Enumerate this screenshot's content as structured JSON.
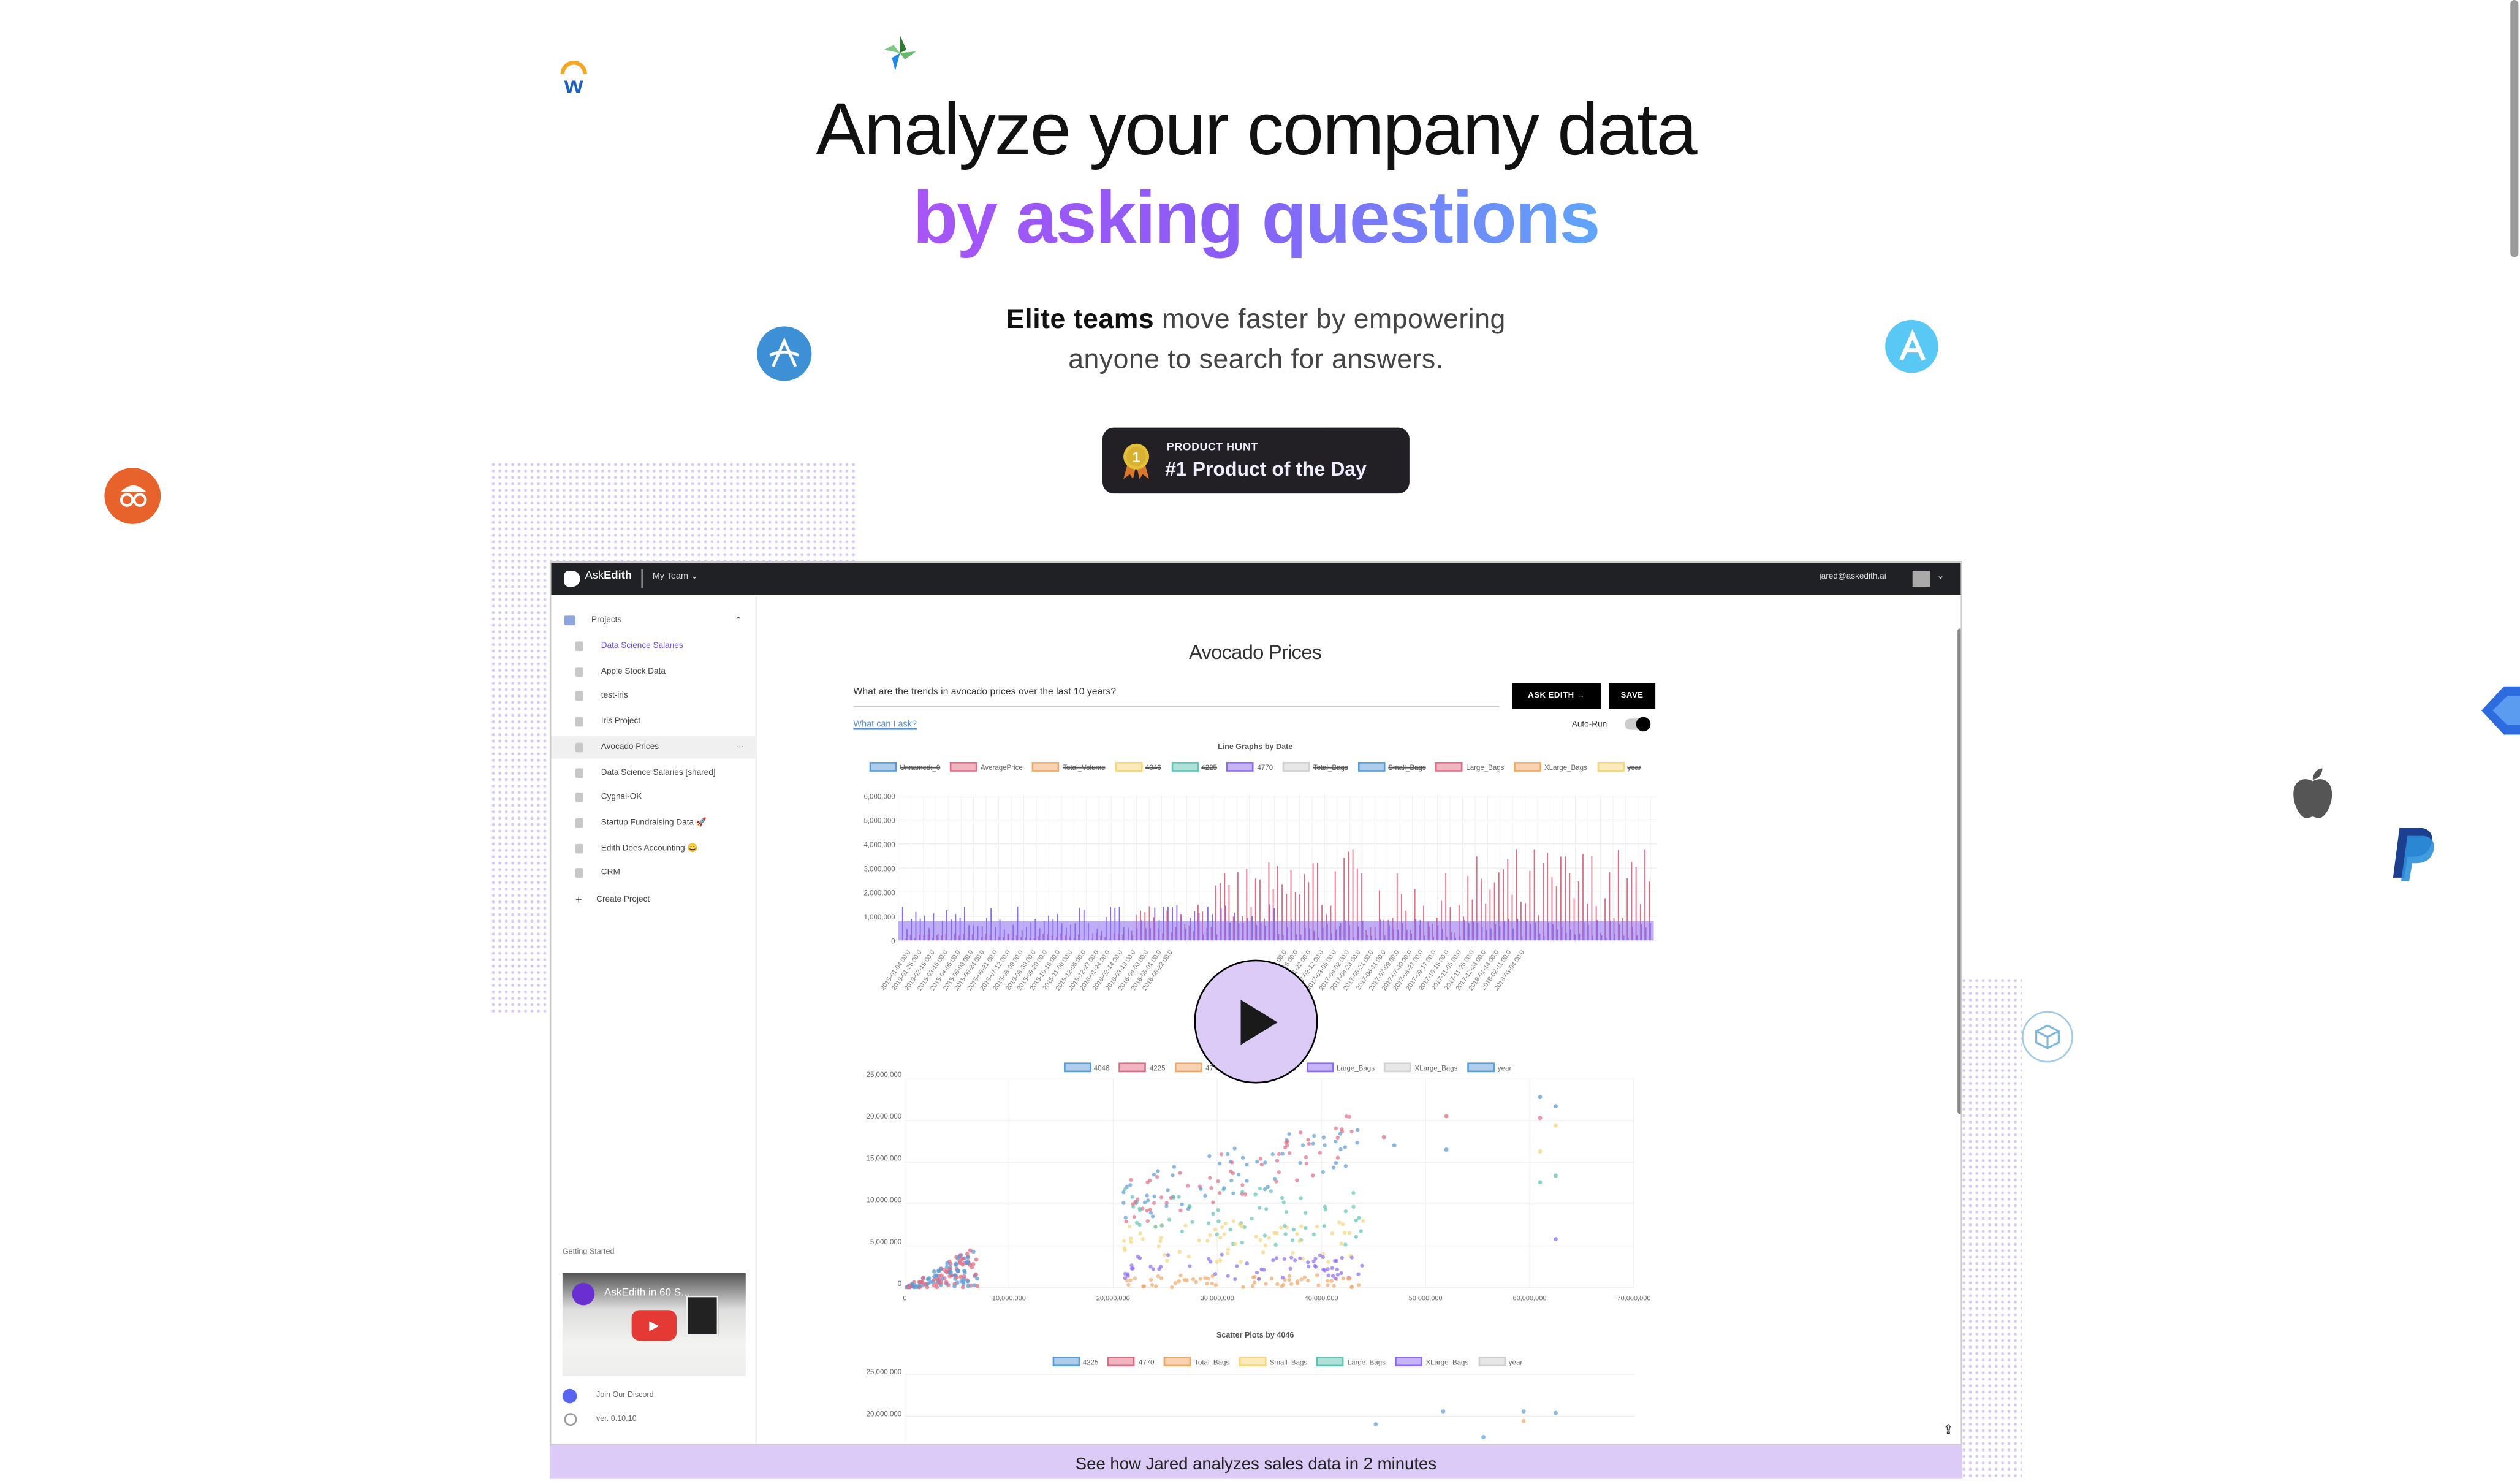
{
  "hero": {
    "title_line1": "Analyze your company data",
    "title_line2": "by asking questions",
    "subtitle_bold": "Elite teams",
    "subtitle_rest": " move faster by empowering",
    "subtitle_line2": "anyone to search for answers."
  },
  "badge": {
    "label": "PRODUCT HUNT",
    "title": "#1 Product of the Day",
    "medal_number": "1"
  },
  "logos": [
    "workday-icon",
    "leaf-diamond-icon",
    "letter-a-circle-icon",
    "letter-a-light-circle-icon",
    "glasses-face-icon",
    "arrow-chevron-icon",
    "apple-icon",
    "paypal-icon",
    "cube-cycle-icon"
  ],
  "app": {
    "brand_prefix": "Ask",
    "brand_suffix": "Edith",
    "team": "My Team",
    "user_email": "jared@askedith.ai",
    "sidebar": {
      "projects_label": "Projects",
      "items": [
        {
          "label": "Data Science Salaries",
          "active": true
        },
        {
          "label": "Apple Stock Data"
        },
        {
          "label": "test-iris"
        },
        {
          "label": "Iris Project"
        },
        {
          "label": "Avocado Prices",
          "selected": true
        },
        {
          "label": "Data Science Salaries [shared]"
        },
        {
          "label": "Cygnal-OK"
        },
        {
          "label": "Startup Fundraising Data 🚀"
        },
        {
          "label": "Edith Does Accounting 😀"
        },
        {
          "label": "CRM"
        }
      ],
      "more": "···",
      "create_project": "Create Project",
      "getting_started": "Getting Started",
      "video_title": "AskEdith in 60 S...",
      "discord": "Join Our Discord",
      "version": "ver. 0.10.10"
    },
    "main": {
      "page_title": "Avocado Prices",
      "query": "What are the trends in avocado prices over the last 10 years?",
      "ask_button": "ASK EDITH →",
      "save_button": "SAVE",
      "help_link": "What can I ask?",
      "autorun_label": "Auto-Run",
      "autorun_on": true
    },
    "chart1": {
      "title": "Line Graphs by Date",
      "legend": [
        {
          "label": "Unnamed:_0",
          "color": "#5b9bd5",
          "hidden": true
        },
        {
          "label": "AveragePrice",
          "color": "#e06c84",
          "hidden": false
        },
        {
          "label": "Total_Volume",
          "color": "#f0a868",
          "hidden": true
        },
        {
          "label": "4046",
          "color": "#f5d67a",
          "hidden": true
        },
        {
          "label": "4225",
          "color": "#5fc4b4",
          "hidden": true
        },
        {
          "label": "4770",
          "color": "#8b6cf0",
          "hidden": false
        },
        {
          "label": "Total_Bags",
          "color": "#d0d0d0",
          "hidden": true
        },
        {
          "label": "Small_Bags",
          "color": "#5b9bd5",
          "hidden": true
        },
        {
          "label": "Large_Bags",
          "color": "#e06c84",
          "hidden": false
        },
        {
          "label": "XLarge_Bags",
          "color": "#f0a868",
          "hidden": false
        },
        {
          "label": "year",
          "color": "#f5d67a",
          "hidden": true
        }
      ],
      "y_ticks": [
        "6,000,000",
        "5,000,000",
        "4,000,000",
        "3,000,000",
        "2,000,000",
        "1,000,000",
        "0"
      ],
      "x_ticks": [
        "2015-01-04 00:0",
        "2015-01-25 00:0",
        "2015-02-15 00:0",
        "2015-03-15 00:0",
        "2015-04-05 00:0",
        "2015-05-03 00:0",
        "2015-05-24 00:0",
        "2015-06-21 00:0",
        "2015-07-12 00:0",
        "2015-08-09 00:0",
        "2015-08-30 00:0",
        "2015-09-20 00:0",
        "2015-10-18 00:0",
        "2015-11-08 00:0",
        "2015-12-06 00:0",
        "2015-12-27 00:0",
        "2016-01-24 00:0",
        "2016-02-14 00:0",
        "2016-03-13 00:0",
        "2016-04-03 00:0",
        "2016-05-01 00:0",
        "2016-05-22 00:0",
        "2016-12-04 00:0",
        "2016-12-25 00:0",
        "2017-01-22 00:0",
        "2017-02-12 00:0",
        "2017-03-05 00:0",
        "2017-04-02 00:0",
        "2017-04-23 00:0",
        "2017-05-21 00:0",
        "2017-06-11 00:0",
        "2017-07-09 00:0",
        "2017-07-30 00:0",
        "2017-08-27 00:0",
        "2017-09-17 00:0",
        "2017-10-15 00:0",
        "2017-11-05 00:0",
        "2017-11-26 00:0",
        "2017-12-24 00:0",
        "2018-01-14 00:0",
        "2018-02-11 00:0",
        "2018-03-04 00:0"
      ]
    },
    "chart2": {
      "legend": [
        {
          "label": "4046",
          "color": "#5b9bd5"
        },
        {
          "label": "4225",
          "color": "#e06c84"
        },
        {
          "label": "4770",
          "color": "#f0a868"
        },
        {
          "label": "Total_Bags",
          "color": "#f5d67a"
        },
        {
          "label": "Large_Bags",
          "color": "#8b6cf0"
        },
        {
          "label": "XLarge_Bags",
          "color": "#d0d0d0"
        },
        {
          "label": "year",
          "color": "#5b9bd5"
        }
      ],
      "y_ticks": [
        "25,000,000",
        "20,000,000",
        "15,000,000",
        "10,000,000",
        "5,000,000",
        "0"
      ],
      "x_ticks": [
        "0",
        "10,000,000",
        "20,000,000",
        "30,000,000",
        "40,000,000",
        "50,000,000",
        "60,000,000",
        "70,000,000"
      ]
    },
    "chart3": {
      "title": "Scatter Plots by 4046",
      "legend": [
        {
          "label": "4225",
          "color": "#5b9bd5"
        },
        {
          "label": "4770",
          "color": "#e06c84"
        },
        {
          "label": "Total_Bags",
          "color": "#f0a868"
        },
        {
          "label": "Small_Bags",
          "color": "#f5d67a"
        },
        {
          "label": "Large_Bags",
          "color": "#5fc4b4"
        },
        {
          "label": "XLarge_Bags",
          "color": "#8b6cf0"
        },
        {
          "label": "year",
          "color": "#d0d0d0"
        }
      ],
      "y_ticks": [
        "25,000,000",
        "20,000,000"
      ]
    }
  },
  "caption": "See how Jared analyzes sales data in 2 minutes",
  "colors": {
    "accent_purple": "#a855f7",
    "accent_blue": "#60a5fa",
    "lavender": "#dccbf6",
    "dark": "#202124"
  }
}
